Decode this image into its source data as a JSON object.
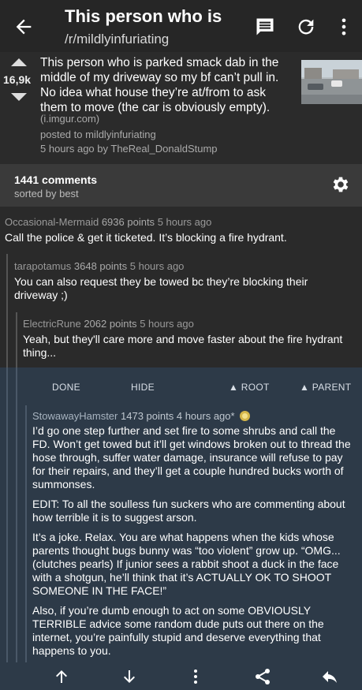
{
  "header": {
    "title": "This person who is parked smack dab in the middle of my driveway",
    "subreddit": "/r/mildlyinfuriating",
    "icons": [
      "back-arrow-icon",
      "comment-icon",
      "refresh-icon",
      "more-vert-icon"
    ]
  },
  "post": {
    "score": "16,9k",
    "title": "This person who is parked smack dab in the middle of my driveway so my bf can’t pull in. No idea what house they’re at/from to ask them to move (the car is obviously empty).",
    "domain": "(i.imgur.com)",
    "posted_to": "posted to mildlyinfuriating",
    "meta": "5 hours ago by TheReal_DonaldStump"
  },
  "comments_bar": {
    "count": "1441 comments",
    "sorted": "sorted by best"
  },
  "comments": [
    {
      "author": "Occasional-Mermaid",
      "points": "6936 points",
      "time": "5 hours ago",
      "body": "Call the police & get it ticketed. It’s blocking a fire hydrant."
    },
    {
      "author": "tarapotamus",
      "points": "3648 points",
      "time": "5 hours ago",
      "body": "You can also request they be towed bc they’re blocking their driveway ;)"
    },
    {
      "author": "ElectricRune",
      "points": "2062 points",
      "time": "5 hours ago",
      "body": "Yeah, but they'll care more and move faster about the fire hydrant thing..."
    }
  ],
  "actions": {
    "done": "DONE",
    "hide": "HIDE",
    "root": "▲ ROOT",
    "parent": "▲ PARENT"
  },
  "selected_comment": {
    "author": "StowawayHamster",
    "points": "1473 points",
    "time": "4 hours ago*",
    "p1": "I’d go one step further and set fire to some shrubs and call the FD. Won’t get towed but it’ll get windows broken out to thread the hose through, suffer water damage, insurance will refuse to pay for their repairs, and they’ll get a couple hundred bucks worth of summonses.",
    "p2": "EDIT: To all the soulless fun suckers who are commenting about how terrible it is to suggest arson.",
    "p3": "It’s a joke. Relax. You are what happens when the kids whose parents thought bugs bunny was “too violent” grow up. “OMG... (clutches pearls) If junior sees a rabbit shoot a duck in the face with a shotgun, he’ll think that it’s ACTUALLY OK TO SHOOT SOMEONE IN THE FACE!”",
    "p4": "Also, if you’re dumb enough to act on some OBVIOUSLY TERRIBLE advice some random dude puts out there on the internet, you’re painfully stupid and deserve everything that happens to you."
  },
  "bottom_bar": {
    "icons": [
      "upvote-icon",
      "downvote-icon",
      "more-vert-icon",
      "share-icon",
      "reply-icon"
    ]
  },
  "colors": {
    "selected_bg": "#2d3a48",
    "author_gold": "#d4b64a"
  }
}
